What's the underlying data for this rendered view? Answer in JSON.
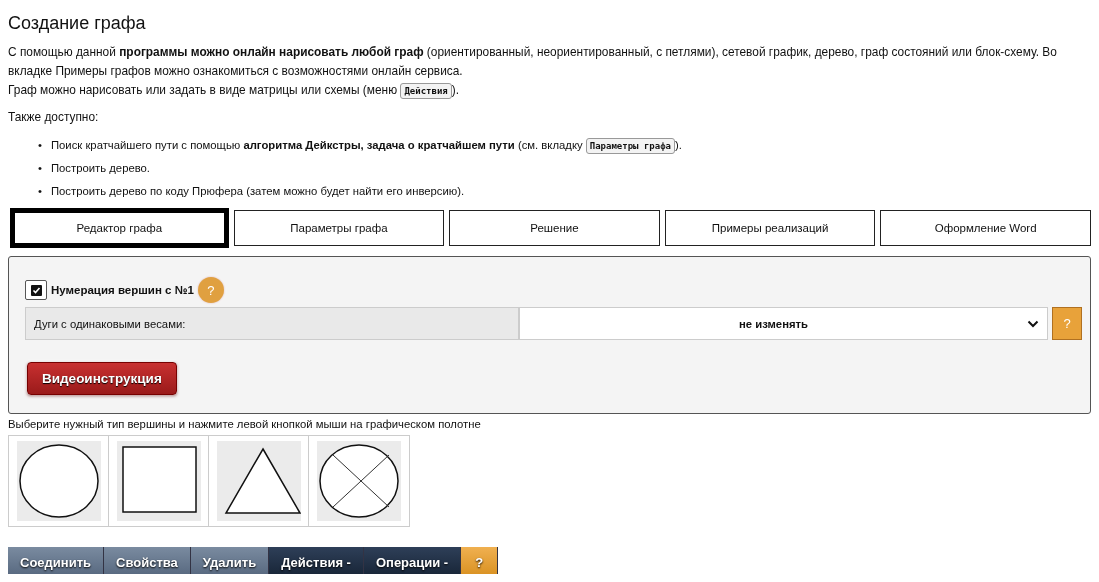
{
  "title": "Создание графа",
  "intro": [
    {
      "before": "С помощью данной **программы можно онлайн нарисовать любой граф** (ориентированный, неориентированный, с петлями), сетевой график, дерево, граф состояний или блок-схему. Во вкладке Примеры графов можно ознакомиться с возможностями онлайн сервиса."
    },
    {
      "before": "Граф можно нарисовать или задать в виде матрицы или схемы (меню ",
      "button": "Действия",
      "after": ")."
    }
  ],
  "also_label": "Также доступно:",
  "features": [
    {
      "marker": "•",
      "before": "Поиск кратчайшего пути с помощью **алгоритма Дейкстры, задача о кратчайшем пути** (см. вкладку ",
      "button": "Параметры  графа",
      "after": ")."
    },
    {
      "marker": "•",
      "before": "Построить дерево."
    },
    {
      "marker": "•",
      "before": "Построить дерево по коду Прюфера (затем можно будет найти его инверсию)."
    }
  ],
  "tabs": [
    {
      "label": "Редактор графа",
      "selected": true
    },
    {
      "label": "Параметры графа",
      "selected": false
    },
    {
      "label": "Решение",
      "selected": false
    },
    {
      "label": "Примеры реализаций",
      "selected": false
    },
    {
      "label": "Оформление Word",
      "selected": false
    }
  ],
  "numbering": {
    "label": "Нумерация вершин с №1",
    "checked": true,
    "help": "?"
  },
  "arcs": {
    "label": "Дуги с одинаковыми весами:",
    "value": "не изменять",
    "help": "?"
  },
  "video_button": "Видеоинструкция",
  "hint": "Выберите нужный тип вершины и нажмите левой кнопкой мыши на графическом полотне",
  "shapes": [
    {
      "kind": "circle"
    },
    {
      "kind": "square"
    },
    {
      "kind": "triangle"
    },
    {
      "kind": "crossed"
    }
  ],
  "toolbar": [
    {
      "label": "Соединить",
      "kind": "light"
    },
    {
      "label": "Свойства",
      "kind": "light"
    },
    {
      "label": "Удалить",
      "kind": "light"
    },
    {
      "label": "Действия -",
      "kind": "dark"
    },
    {
      "label": "Операции -",
      "kind": "dark"
    },
    {
      "label": "?",
      "kind": "help"
    }
  ]
}
